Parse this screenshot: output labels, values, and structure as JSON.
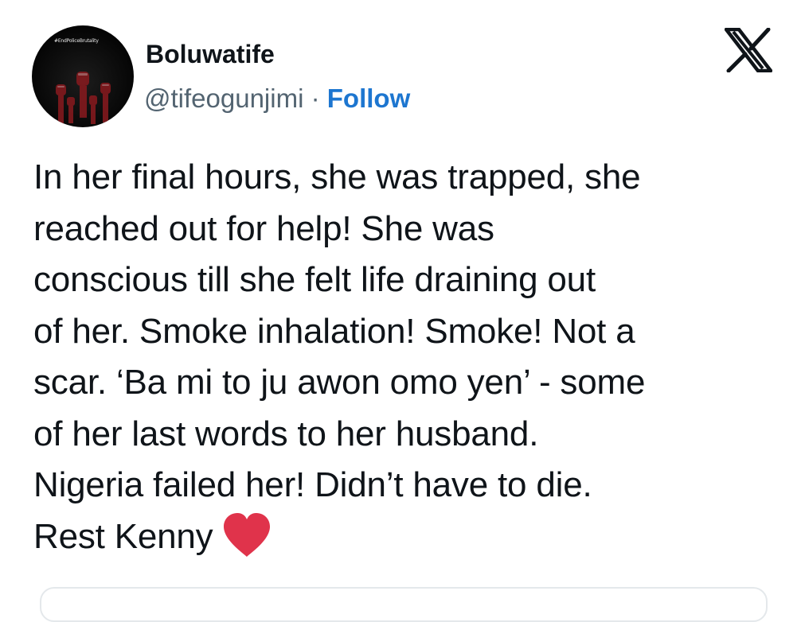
{
  "tweet": {
    "avatar": {
      "badge_text": "#EndPoliceBrutality",
      "icon": "raised-fists-icon"
    },
    "display_name": "Boluwatife",
    "handle": "@tifeogunjimi",
    "separator": "·",
    "follow_label": "Follow",
    "platform_icon": "x-logo-icon",
    "text_lines": [
      "In her final hours, she was trapped, she",
      "reached out for help! She was",
      "conscious till she felt life draining out",
      "of her. Smoke inhalation! Smoke! Not a",
      "scar. ‘Ba mi to ju awon omo yen’ - some",
      "of her last words to her husband.",
      "Nigeria failed her! Didn’t have to die.",
      "Rest Kenny"
    ],
    "emoji": "red-heart-icon"
  },
  "colors": {
    "text": "#0f1419",
    "secondary": "#536471",
    "link": "#1d76d0",
    "heart": "#e0334b"
  }
}
